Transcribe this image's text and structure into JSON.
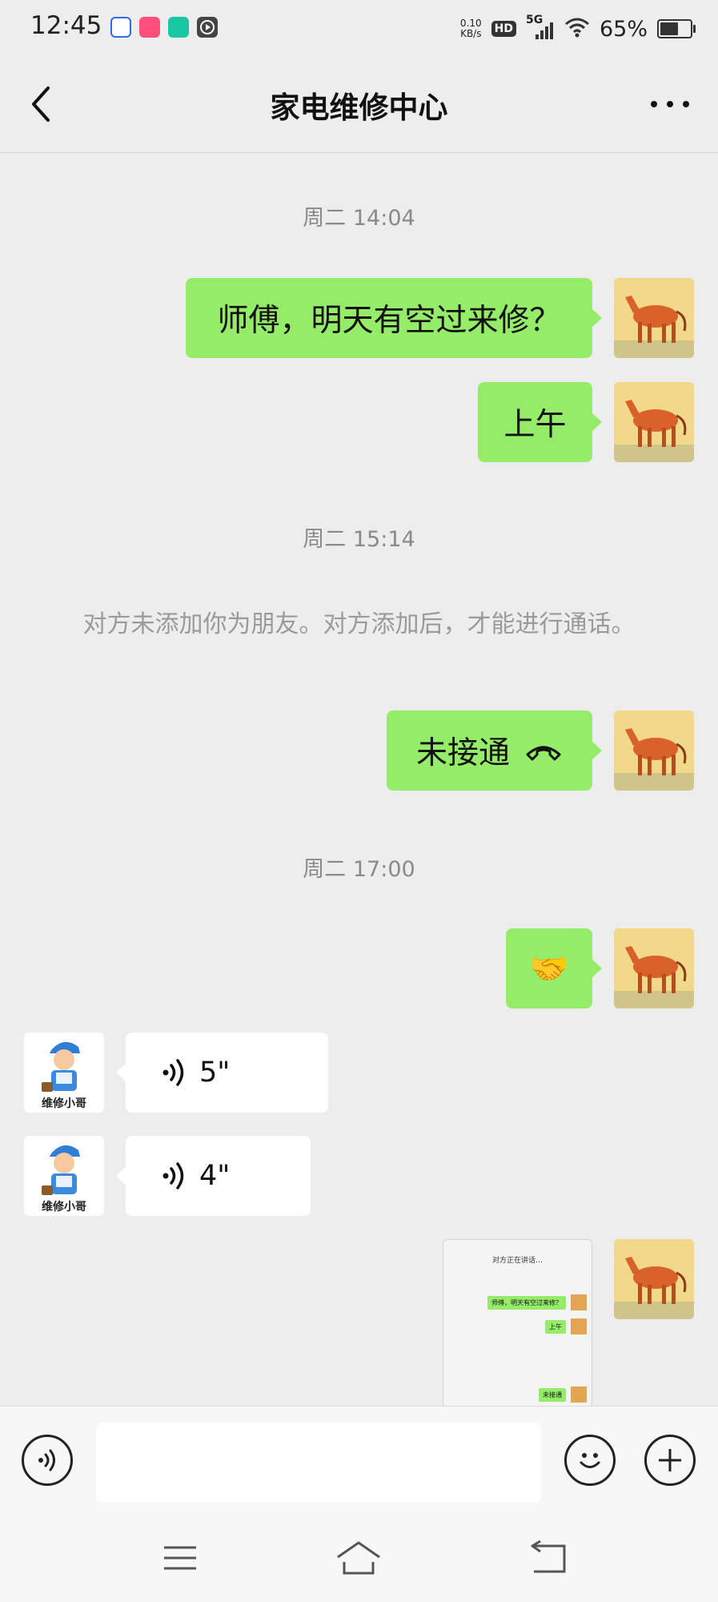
{
  "status_bar": {
    "time": "12:45",
    "net_speed_value": "0.10",
    "net_speed_unit": "KB/s",
    "hd": "HD",
    "network": "5G",
    "battery_percent": "65%",
    "battery_level": 0.65
  },
  "header": {
    "title": "家电维修中心",
    "back_icon": "chevron-left-icon",
    "more_icon": "more-dots-icon"
  },
  "messages": {
    "time_1": "周二 14:04",
    "msg_1": "师傅，明天有空过来修？",
    "msg_2": "上午",
    "time_2": "周二 15:14",
    "notice": "对方未添加你为朋友。对方添加后，才能进行通话。",
    "msg_3": "未接通",
    "time_3": "周二 17:00",
    "msg_4_emoji": "🤝",
    "voice_1": "5\"",
    "voice_2": "4\"",
    "other_avatar_caption": "维修小哥"
  },
  "screenshot_thumb": {
    "title": "对方正在讲话…",
    "msg_1": "师傅，明天有空过来修？",
    "msg_2": "上午",
    "msg_3": "未接通"
  },
  "input_bar": {
    "voice_icon": "voice-icon",
    "emoji_icon": "smiley-icon",
    "plus_icon": "plus-icon",
    "placeholder": ""
  },
  "nav": {
    "menu_icon": "menu-icon",
    "home_icon": "home-icon",
    "back_icon": "back-icon"
  },
  "colors": {
    "background": "#ededed",
    "bubble_out": "#95ec69",
    "bubble_in": "#ffffff"
  }
}
